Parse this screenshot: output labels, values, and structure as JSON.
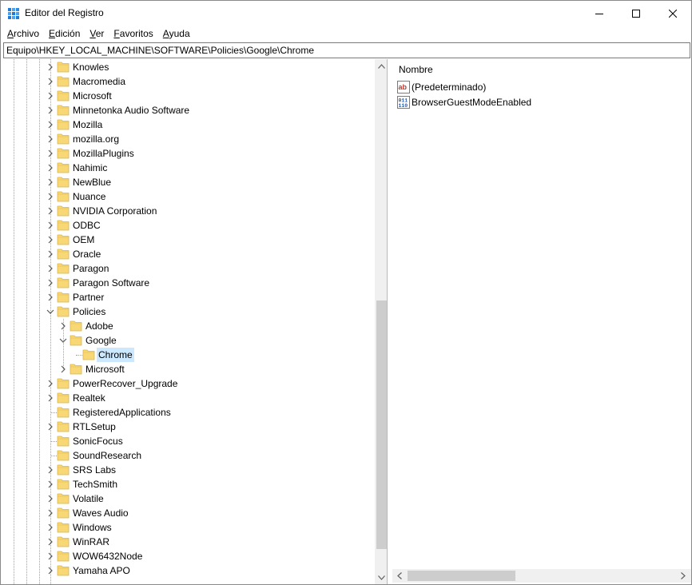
{
  "window": {
    "title": "Editor del Registro"
  },
  "menu": {
    "items": [
      {
        "label": "Archivo",
        "accel": "A",
        "rest": "rchivo"
      },
      {
        "label": "Edición",
        "accel": "E",
        "rest": "dición"
      },
      {
        "label": "Ver",
        "accel": "V",
        "rest": "er"
      },
      {
        "label": "Favoritos",
        "accel": "F",
        "rest": "avoritos"
      },
      {
        "label": "Ayuda",
        "accel": "A",
        "rest": "yuda"
      }
    ]
  },
  "address": {
    "path": "Equipo\\HKEY_LOCAL_MACHINE\\SOFTWARE\\Policies\\Google\\Chrome"
  },
  "tree": {
    "items": [
      {
        "label": "Knowles",
        "level": 0,
        "expander": "collapsed"
      },
      {
        "label": "Macromedia",
        "level": 0,
        "expander": "collapsed"
      },
      {
        "label": "Microsoft",
        "level": 0,
        "expander": "collapsed"
      },
      {
        "label": "Minnetonka Audio Software",
        "level": 0,
        "expander": "collapsed"
      },
      {
        "label": "Mozilla",
        "level": 0,
        "expander": "collapsed"
      },
      {
        "label": "mozilla.org",
        "level": 0,
        "expander": "collapsed"
      },
      {
        "label": "MozillaPlugins",
        "level": 0,
        "expander": "collapsed"
      },
      {
        "label": "Nahimic",
        "level": 0,
        "expander": "collapsed"
      },
      {
        "label": "NewBlue",
        "level": 0,
        "expander": "collapsed"
      },
      {
        "label": "Nuance",
        "level": 0,
        "expander": "collapsed"
      },
      {
        "label": "NVIDIA Corporation",
        "level": 0,
        "expander": "collapsed"
      },
      {
        "label": "ODBC",
        "level": 0,
        "expander": "collapsed"
      },
      {
        "label": "OEM",
        "level": 0,
        "expander": "collapsed"
      },
      {
        "label": "Oracle",
        "level": 0,
        "expander": "collapsed"
      },
      {
        "label": "Paragon",
        "level": 0,
        "expander": "collapsed"
      },
      {
        "label": "Paragon Software",
        "level": 0,
        "expander": "collapsed"
      },
      {
        "label": "Partner",
        "level": 0,
        "expander": "collapsed"
      },
      {
        "label": "Policies",
        "level": 0,
        "expander": "expanded"
      },
      {
        "label": "Adobe",
        "level": 1,
        "expander": "collapsed"
      },
      {
        "label": "Google",
        "level": 1,
        "expander": "expanded"
      },
      {
        "label": "Chrome",
        "level": 2,
        "expander": "none",
        "selected": true
      },
      {
        "label": "Microsoft",
        "level": 1,
        "expander": "collapsed"
      },
      {
        "label": "PowerRecover_Upgrade",
        "level": 0,
        "expander": "collapsed"
      },
      {
        "label": "Realtek",
        "level": 0,
        "expander": "collapsed"
      },
      {
        "label": "RegisteredApplications",
        "level": 0,
        "expander": "none"
      },
      {
        "label": "RTLSetup",
        "level": 0,
        "expander": "collapsed"
      },
      {
        "label": "SonicFocus",
        "level": 0,
        "expander": "none"
      },
      {
        "label": "SoundResearch",
        "level": 0,
        "expander": "none"
      },
      {
        "label": "SRS Labs",
        "level": 0,
        "expander": "collapsed"
      },
      {
        "label": "TechSmith",
        "level": 0,
        "expander": "collapsed"
      },
      {
        "label": "Volatile",
        "level": 0,
        "expander": "collapsed"
      },
      {
        "label": "Waves Audio",
        "level": 0,
        "expander": "collapsed"
      },
      {
        "label": "Windows",
        "level": 0,
        "expander": "collapsed"
      },
      {
        "label": "WinRAR",
        "level": 0,
        "expander": "collapsed"
      },
      {
        "label": "WOW6432Node",
        "level": 0,
        "expander": "collapsed"
      },
      {
        "label": "Yamaha APO",
        "level": 0,
        "expander": "collapsed"
      }
    ]
  },
  "values": {
    "column_header": "Nombre",
    "items": [
      {
        "name": "(Predeterminado)",
        "icon": "string-value-icon"
      },
      {
        "name": "BrowserGuestModeEnabled",
        "icon": "binary-value-icon"
      }
    ]
  },
  "colors": {
    "selection": "#cce8ff",
    "folder": "#f8d775",
    "scrollbar_track": "#f0f0f0",
    "scrollbar_thumb": "#cdcdcd"
  }
}
